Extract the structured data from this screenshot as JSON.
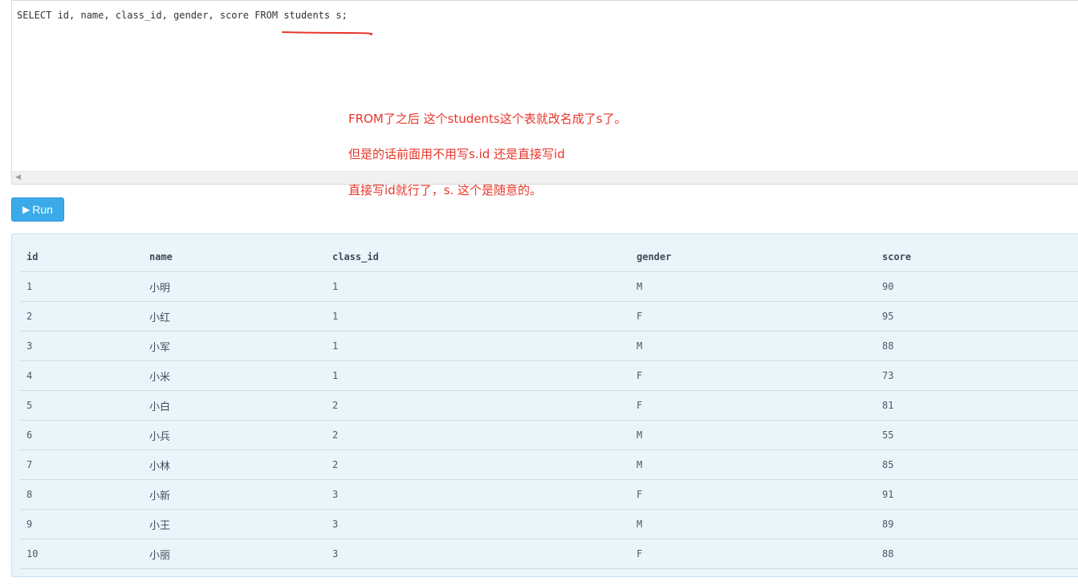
{
  "editor": {
    "sql": "SELECT id, name, class_id, gender, score FROM students s;"
  },
  "annotations": [
    "FROM了之后 这个students这个表就改名成了s了。",
    "但是的话前面用不用写s.id 还是直接写id",
    "直接写id就行了，s. 这个是随意的。"
  ],
  "colors": {
    "annotation": "#e8362a",
    "run_button": "#3aabe8",
    "result_bg": "#eaf5fb"
  },
  "toolbar": {
    "run_icon": "play-icon",
    "run_label": "Run"
  },
  "result": {
    "columns": [
      "id",
      "name",
      "class_id",
      "gender",
      "score"
    ],
    "rows": [
      [
        "1",
        "小明",
        "1",
        "M",
        "90"
      ],
      [
        "2",
        "小红",
        "1",
        "F",
        "95"
      ],
      [
        "3",
        "小军",
        "1",
        "M",
        "88"
      ],
      [
        "4",
        "小米",
        "1",
        "F",
        "73"
      ],
      [
        "5",
        "小白",
        "2",
        "F",
        "81"
      ],
      [
        "6",
        "小兵",
        "2",
        "M",
        "55"
      ],
      [
        "7",
        "小林",
        "2",
        "M",
        "85"
      ],
      [
        "8",
        "小新",
        "3",
        "F",
        "91"
      ],
      [
        "9",
        "小王",
        "3",
        "M",
        "89"
      ],
      [
        "10",
        "小丽",
        "3",
        "F",
        "88"
      ]
    ]
  }
}
